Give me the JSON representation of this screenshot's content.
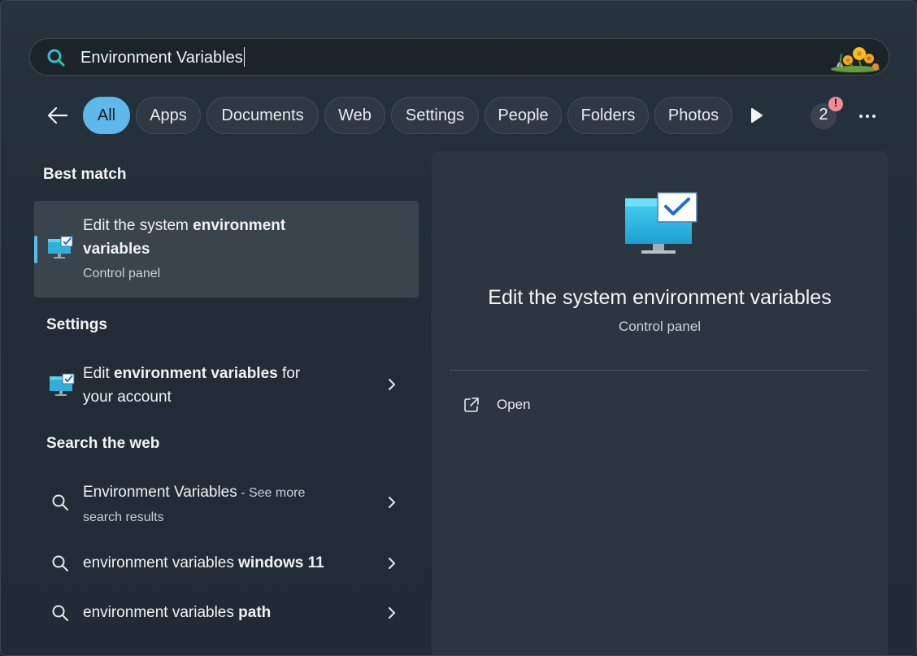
{
  "search": {
    "value": "Environment Variables",
    "icon": "search-icon",
    "highlight": "flowers-highlight-icon"
  },
  "filters": {
    "back_icon": "back-arrow-icon",
    "chips": [
      {
        "label": "All",
        "active": true
      },
      {
        "label": "Apps",
        "active": false
      },
      {
        "label": "Documents",
        "active": false
      },
      {
        "label": "Web",
        "active": false
      },
      {
        "label": "Settings",
        "active": false
      },
      {
        "label": "People",
        "active": false
      },
      {
        "label": "Folders",
        "active": false
      },
      {
        "label": "Photos",
        "active": false
      }
    ],
    "more_filters_icon": "play-icon",
    "notification_count": "2",
    "more_icon": "ellipsis-icon"
  },
  "sections": {
    "best_match": "Best match",
    "settings": "Settings",
    "search_web": "Search the web"
  },
  "best_match_item": {
    "title_plain": "Edit the system ",
    "title_bold": "environment",
    "title_line2": "variables",
    "subtitle": "Control panel",
    "icon": "environment-variables-icon"
  },
  "settings_item": {
    "prefix": "Edit ",
    "bold": "environment variables",
    "suffix": " for",
    "line2": "your account",
    "icon": "environment-variables-icon"
  },
  "web_items": [
    {
      "main": "Environment Variables",
      "extra": " - See more",
      "line2": "search results"
    },
    {
      "plain": "environment variables ",
      "bold": "windows 11"
    },
    {
      "plain": "environment variables ",
      "bold": "path"
    }
  ],
  "detail": {
    "title": "Edit the system environment variables",
    "subtitle": "Control panel",
    "action_label": "Open",
    "action_icon": "open-external-icon"
  },
  "colors": {
    "accent": "#5fb8ea",
    "alert": "#ee8d96",
    "background": "#222d37"
  }
}
